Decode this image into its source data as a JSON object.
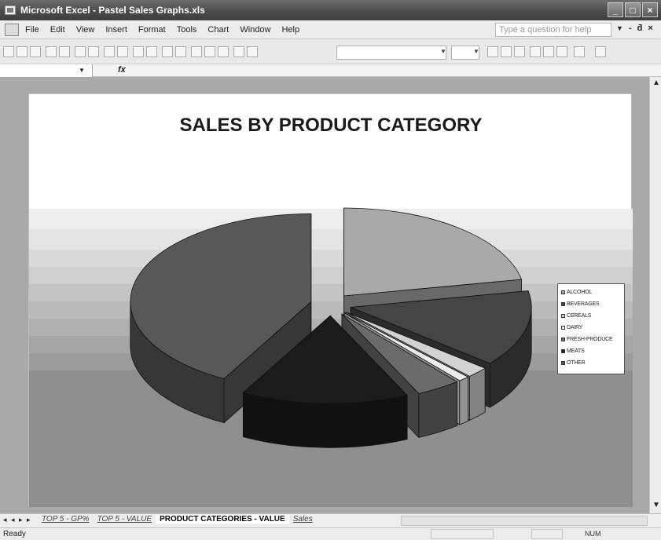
{
  "window": {
    "title": "Microsoft Excel - Pastel Sales Graphs.xls",
    "buttons": [
      "_",
      "□",
      "×"
    ]
  },
  "menu": {
    "items": [
      "File",
      "Edit",
      "View",
      "Insert",
      "Format",
      "Tools",
      "Chart",
      "Window",
      "Help"
    ],
    "ask_placeholder": "Type a question for help",
    "doc_controls": [
      "▾",
      "-",
      "ƌ",
      "×"
    ]
  },
  "formula_bar": {
    "fx": "fx"
  },
  "chart": {
    "title": "SALES BY PRODUCT CATEGORY",
    "legend": [
      "ALCOHOL",
      "BEVERAGES",
      "CEREALS",
      "DAIRY",
      "FRESH-PRODUCE",
      "MEATS",
      "OTHER"
    ]
  },
  "chart_data": {
    "type": "pie",
    "title": "SALES BY PRODUCT CATEGORY",
    "categories": [
      "ALCOHOL",
      "BEVERAGES",
      "CEREALS",
      "DAIRY",
      "FRESH-PRODUCE",
      "MEATS",
      "OTHER"
    ],
    "values": [
      22,
      14,
      2,
      1,
      4,
      15,
      42
    ],
    "units": "percent of total (estimated)",
    "style": "3D exploded pie",
    "legend_position": "right",
    "colors": [
      "#a9a9a9",
      "#454545",
      "#d2d2d2",
      "#ececec",
      "#6b6b6b",
      "#1b1b1b",
      "#585858"
    ]
  },
  "sheet_tabs": {
    "nav": [
      "◂",
      "◂",
      "▸",
      "▸"
    ],
    "tabs": [
      "TOP 5 - GP%",
      "TOP 5 - VALUE",
      "PRODUCT CATEGORIES - VALUE",
      "Sales"
    ],
    "active": 2
  },
  "status": {
    "ready": "Ready",
    "num": "NUM"
  }
}
